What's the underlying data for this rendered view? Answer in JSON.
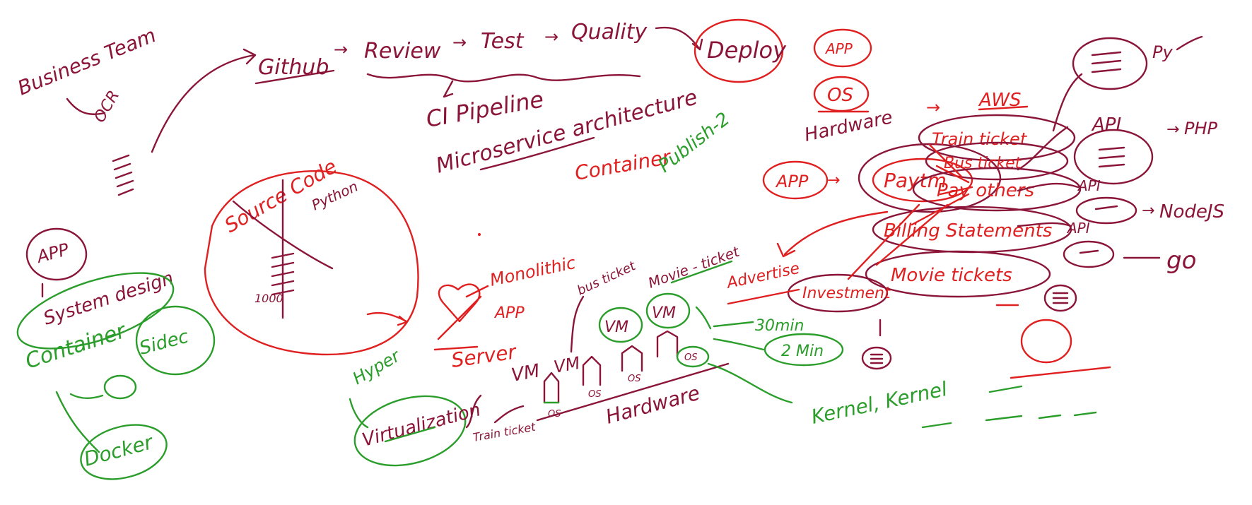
{
  "colors": {
    "dark_red": "#8b1538",
    "red": "#e02020",
    "green": "#2a9d2a",
    "background": "#ffffff"
  },
  "labels": {
    "business_team": "Business Team",
    "ocr": "OCR",
    "github": "Github",
    "review": "Review",
    "test": "Test",
    "quality": "Quality",
    "deploy": "Deploy",
    "ci_pipeline": "CI Pipeline",
    "microservice_architecture": "Microservice architecture",
    "container_top": "Container",
    "app_top": "APP",
    "os_top": "OS",
    "hardware": "Hardware",
    "aws": "AWS",
    "train_ticket": "Train ticket",
    "bus_ticket": "Bus ticket",
    "pay_others": "Pay others",
    "billing_statements": "Billing Statements",
    "movie_tickets": "Movie tickets",
    "paytm": "Paytm",
    "app_paytm": "APP",
    "publish_2": "Publish-2",
    "advertise": "Advertise",
    "investment": "Investment",
    "py": "Py",
    "api_1": "API",
    "php": "PHP",
    "api_2": "API",
    "nodejs": "NodeJS",
    "api_3": "API",
    "go": "go",
    "app_left": "APP",
    "system_design": "System design",
    "container_left": "Container",
    "sidecar": "Sidec",
    "docker": "Docker",
    "source_code": "Source Code",
    "python": "Python",
    "thousand": "1000",
    "monolithic": "Monolithic",
    "app_mid": "APP",
    "server": "Server",
    "hyper": "Hyper",
    "virtualization": "Virtualization",
    "vm_1": "VM",
    "vm_2": "VM",
    "vm_3": "VM",
    "vm_4": "VM",
    "bus_ticket_mid": "bus ticket",
    "movie_ticket_mid": "Movie - ticket",
    "train_ticket_mid": "Train ticket",
    "os_1": "OS",
    "os_2": "OS",
    "os_3": "OS",
    "os_4": "OS",
    "hardware_mid": "Hardware",
    "thirty_min": "30min",
    "two_min": "2 Min",
    "kernel": "Kernel, Kernel"
  }
}
